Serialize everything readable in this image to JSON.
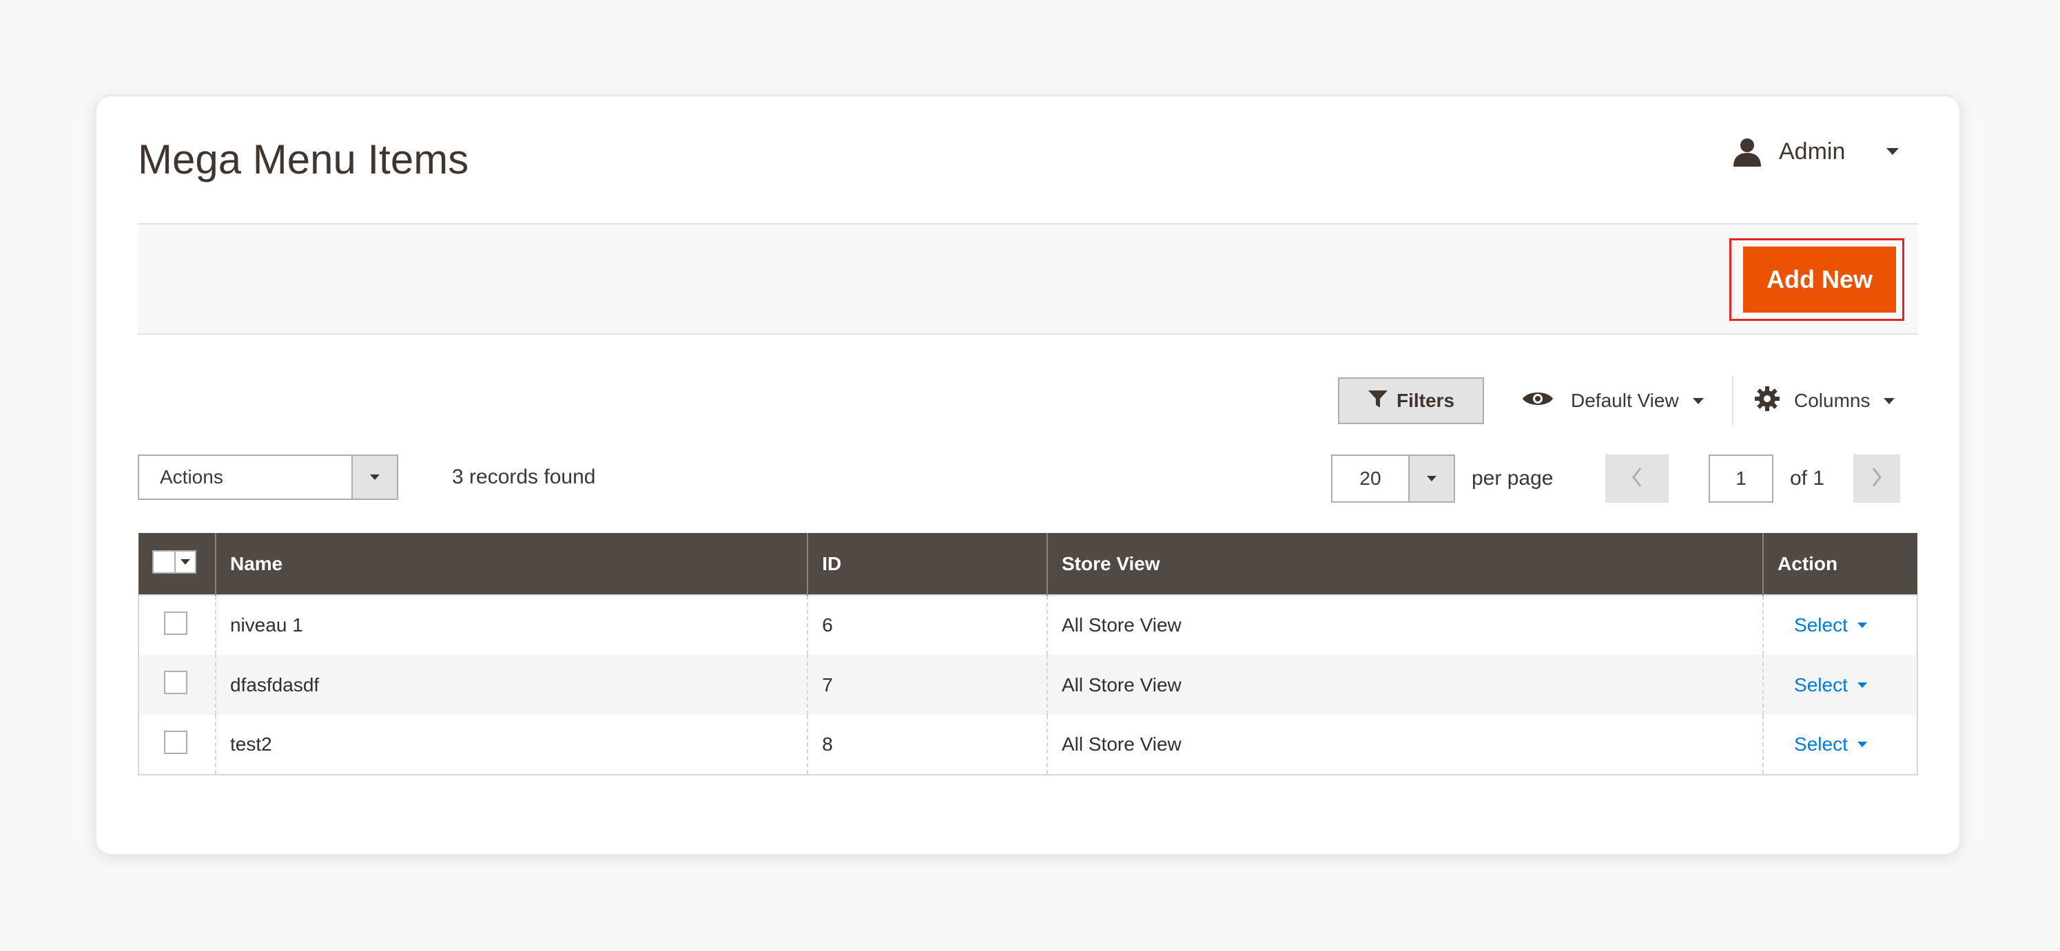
{
  "header": {
    "title": "Mega Menu Items",
    "user": {
      "name": "Admin",
      "icon": "user-icon"
    }
  },
  "toolbar": {
    "add_new_label": "Add New",
    "filters_label": "Filters",
    "view_label": "Default View",
    "columns_label": "Columns"
  },
  "grid_controls": {
    "actions_value": "Actions",
    "records_text": "3 records found",
    "per_page_value": "20",
    "per_page_label": "per page",
    "current_page": "1",
    "total_pages_text": "of 1"
  },
  "table": {
    "columns": [
      "Name",
      "ID",
      "Store View",
      "Action"
    ],
    "rows": [
      {
        "name": "niveau 1",
        "id": "6",
        "store_view": "All Store View",
        "action": "Select"
      },
      {
        "name": "dfasfdasdf",
        "id": "7",
        "store_view": "All Store View",
        "action": "Select"
      },
      {
        "name": "test2",
        "id": "8",
        "store_view": "All Store View",
        "action": "Select"
      }
    ]
  },
  "colors": {
    "accent": "#eb5202",
    "highlight_outline": "#e22626",
    "table_header": "#514943",
    "link": "#007bdb"
  }
}
